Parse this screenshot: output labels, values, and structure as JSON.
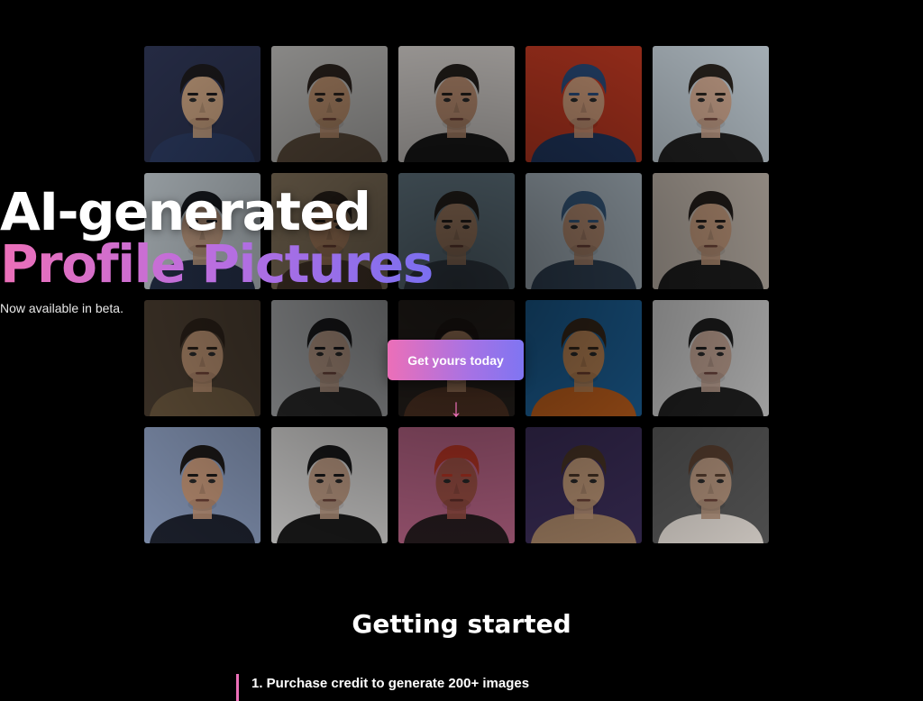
{
  "hero": {
    "headline_line1": "AI-generated",
    "headline_line2": "Profile Pictures",
    "subtitle": "Now available in beta.",
    "cta_label": "Get yours today",
    "arrow_glyph": "↓",
    "tiles": [
      {
        "bg": "#2c3350",
        "skin": "#c7a07f",
        "hair": "#1c1a1c",
        "shirt": "#2d3c63"
      },
      {
        "bg": "#b8b6b4",
        "skin": "#b68c6b",
        "hair": "#2a221d",
        "shirt": "#5a4a3b"
      },
      {
        "bg": "#d8d4d0",
        "skin": "#c09274",
        "hair": "#25201c",
        "shirt": "#1a1a1a"
      },
      {
        "bg": "#c23a22",
        "skin": "#cf9c7c",
        "hair": "#2a4c7c",
        "shirt": "#223a64"
      },
      {
        "bg": "#c5d0d8",
        "skin": "#d2aa92",
        "hair": "#2a241f",
        "shirt": "#222222"
      },
      {
        "bg": "#c7d0d6",
        "skin": "#c9a488",
        "hair": "#191c22",
        "shirt": "#27324c"
      },
      {
        "bg": "#8c7a62",
        "skin": "#b18563",
        "hair": "#2c231c",
        "shirt": "#4a3a2d"
      },
      {
        "bg": "#6f8592",
        "skin": "#b58d70",
        "hair": "#29231f",
        "shirt": "#3c4752"
      },
      {
        "bg": "#b8c6d0",
        "skin": "#c2967a",
        "hair": "#3a5f86",
        "shirt": "#36495e"
      },
      {
        "bg": "#c2b7ad",
        "skin": "#c49b7e",
        "hair": "#231d1a",
        "shirt": "#1e1e1e"
      },
      {
        "bg": "#4a3d30",
        "skin": "#b88f70",
        "hair": "#2b2119",
        "shirt": "#6d5a40"
      },
      {
        "bg": "#b2b4b6",
        "skin": "#bfa08c",
        "hair": "#1b1b1d",
        "shirt": "#2a2a2a"
      },
      {
        "bg": "#2a2420",
        "skin": "#b68a68",
        "hair": "#211915",
        "shirt": "#5b3a28"
      },
      {
        "bg": "#1f6aa6",
        "skin": "#c88e5c",
        "hair": "#3a2a1c",
        "shirt": "#d0681e"
      },
      {
        "bg": "#d4d4d4",
        "skin": "#c6a797",
        "hair": "#1e1e1f",
        "shirt": "#222222"
      },
      {
        "bg": "#8ea0c2",
        "skin": "#c99a7c",
        "hair": "#1d1a19",
        "shirt": "#1f2330"
      },
      {
        "bg": "#e0dedd",
        "skin": "#c9a58c",
        "hair": "#1a1a1b",
        "shirt": "#1c1c1c"
      },
      {
        "bg": "#c46b90",
        "skin": "#a8564a",
        "hair": "#c43a28",
        "shirt": "#2a1f22"
      },
      {
        "bg": "#3d2f5c",
        "skin": "#c59c7c",
        "hair": "#4a3526",
        "shirt": "#b08c6c"
      },
      {
        "bg": "#5b5b5b",
        "skin": "#b99880",
        "hair": "#5a4030",
        "shirt": "#e6e0d8"
      }
    ]
  },
  "getting_started": {
    "title": "Getting started",
    "step1": "1. Purchase credit to generate 200+ images"
  }
}
